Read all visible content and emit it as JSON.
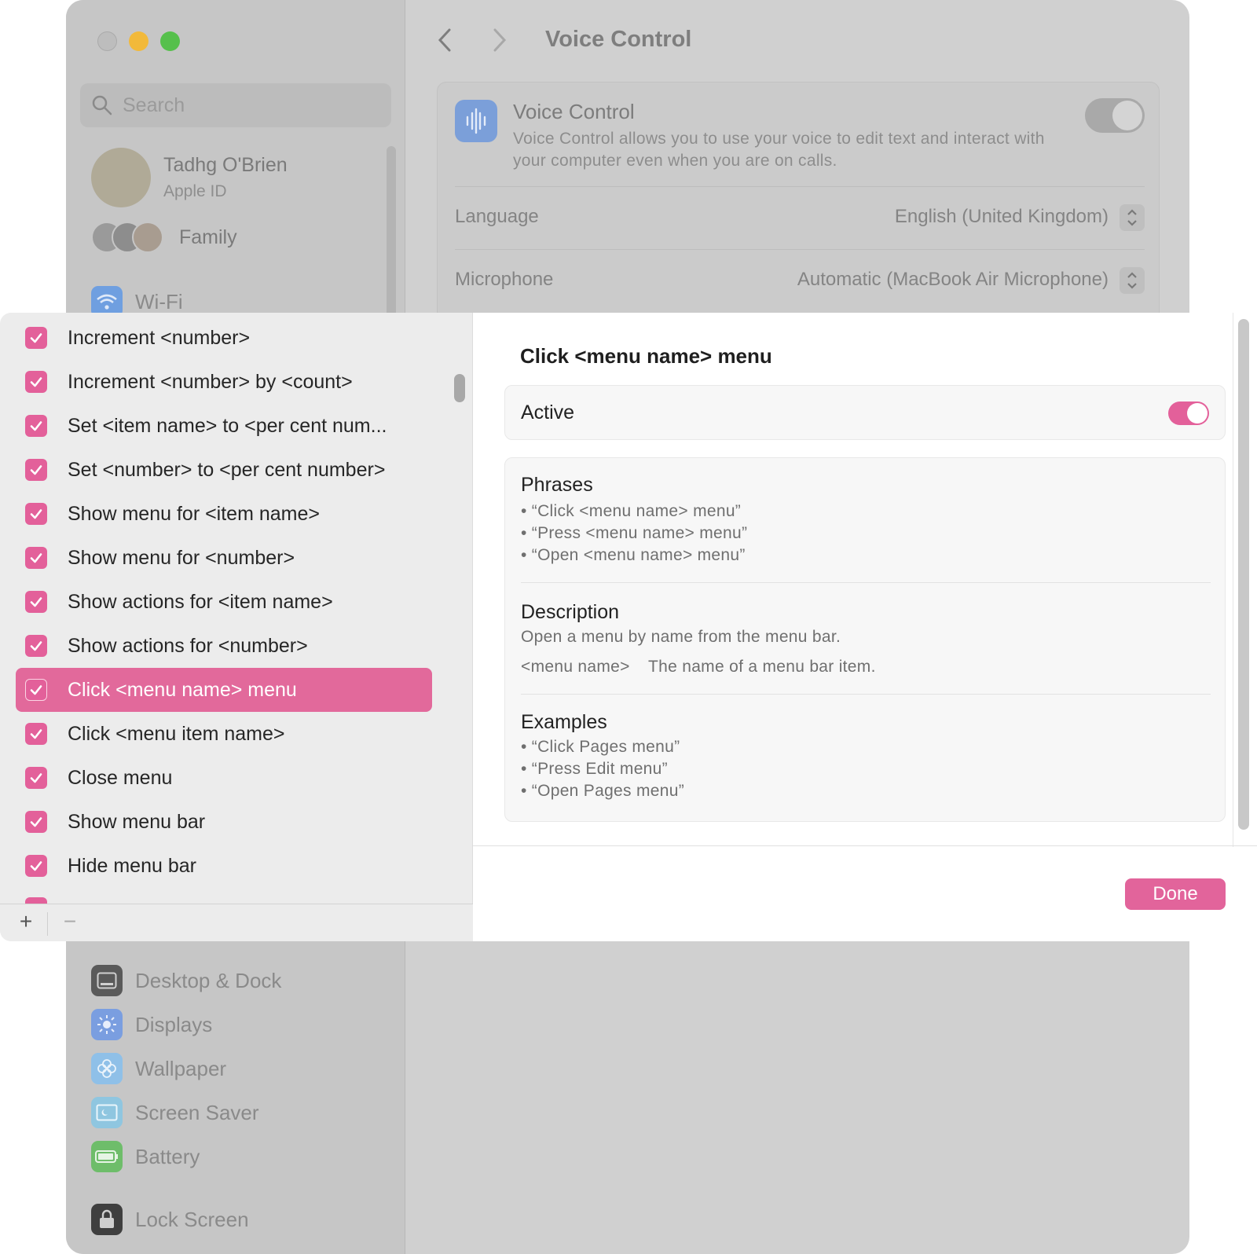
{
  "window": {
    "title": "Voice Control"
  },
  "sidebar": {
    "search_placeholder": "Search",
    "user": {
      "name": "Tadhg O'Brien",
      "subtitle": "Apple ID"
    },
    "family_label": "Family",
    "items": [
      {
        "label": "Wi-Fi",
        "icon": "wifi-icon",
        "color": "#6f9fe0"
      },
      {
        "label": "Desktop & Dock",
        "icon": "dock-icon",
        "color": "#5a5a5a"
      },
      {
        "label": "Displays",
        "icon": "sun-icon",
        "color": "#7a9ee0"
      },
      {
        "label": "Wallpaper",
        "icon": "flower-icon",
        "color": "#8fc0e8"
      },
      {
        "label": "Screen Saver",
        "icon": "screen-saver-icon",
        "color": "#8fc6e0"
      },
      {
        "label": "Battery",
        "icon": "battery-icon",
        "color": "#6ebd6a"
      },
      {
        "label": "Lock Screen",
        "icon": "lock-icon",
        "color": "#3f3f3f"
      }
    ]
  },
  "voice_control": {
    "title": "Voice Control",
    "description": "Voice Control allows you to use your voice to edit text and interact with your computer even when you are on calls.",
    "enabled": false,
    "language_label": "Language",
    "language_value": "English (United Kingdom)",
    "microphone_label": "Microphone",
    "microphone_value": "Automatic (MacBook Air Microphone)"
  },
  "commands": [
    {
      "label": "Increment <number>",
      "checked": true
    },
    {
      "label": "Increment <number> by <count>",
      "checked": true
    },
    {
      "label": "Set <item name> to <per cent num...",
      "checked": true
    },
    {
      "label": "Set <number> to <per cent number>",
      "checked": true
    },
    {
      "label": "Show menu for <item name>",
      "checked": true
    },
    {
      "label": "Show menu for <number>",
      "checked": true
    },
    {
      "label": "Show actions for <item name>",
      "checked": true
    },
    {
      "label": "Show actions for <number>",
      "checked": true
    },
    {
      "label": "Click <menu name> menu",
      "checked": true,
      "selected": true
    },
    {
      "label": "Click <menu item name>",
      "checked": true
    },
    {
      "label": "Close menu",
      "checked": true
    },
    {
      "label": "Show menu bar",
      "checked": true
    },
    {
      "label": "Hide menu bar",
      "checked": true
    }
  ],
  "footer": {
    "add": "+",
    "remove": "−"
  },
  "detail": {
    "title": "Click <menu name> menu",
    "active_label": "Active",
    "active": true,
    "phrases_heading": "Phrases",
    "phrases": [
      "•  “Click <menu name> menu”",
      "•  “Press <menu name> menu”",
      "•  “Open <menu name> menu”"
    ],
    "description_heading": "Description",
    "description": "Open a menu by name from the menu bar.",
    "parameter_name": "<menu name>",
    "parameter_desc": "The name of a menu bar item.",
    "examples_heading": "Examples",
    "examples": [
      "•  “Click Pages menu”",
      "•  “Press Edit menu”",
      "•  “Open Pages menu”"
    ],
    "done_label": "Done"
  },
  "colors": {
    "accent": "#e3609a"
  }
}
